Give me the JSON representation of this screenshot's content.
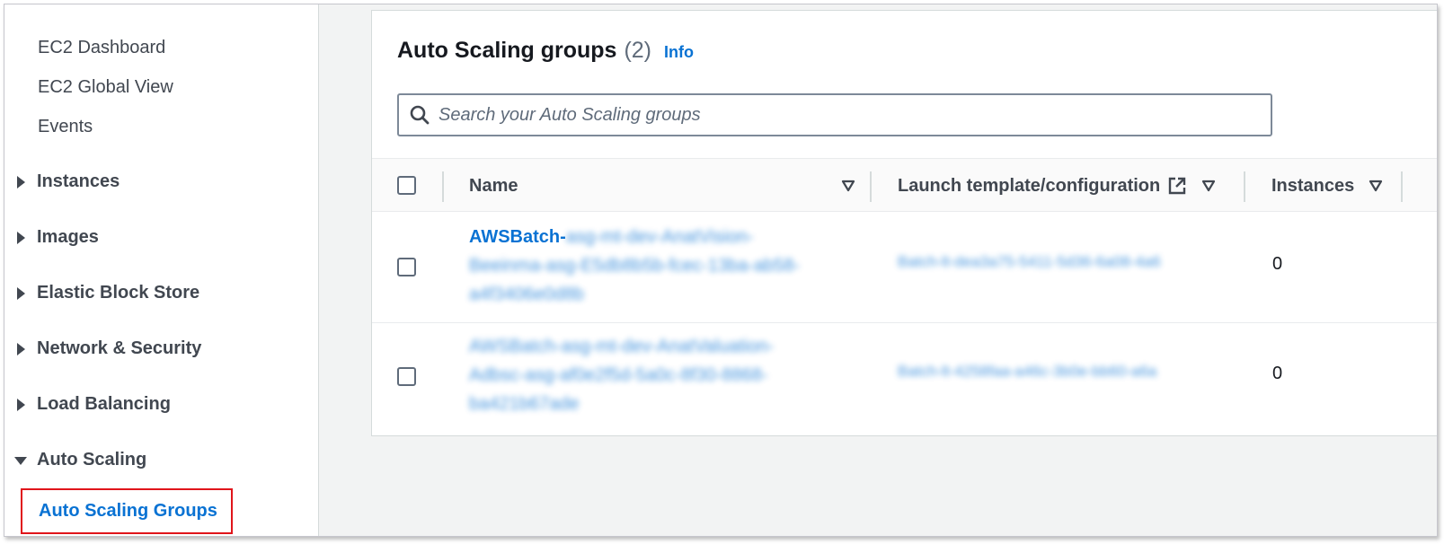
{
  "sidebar": {
    "links": [
      "EC2 Dashboard",
      "EC2 Global View",
      "Events"
    ],
    "sections": [
      "Instances",
      "Images",
      "Elastic Block Store",
      "Network & Security",
      "Load Balancing",
      "Auto Scaling"
    ],
    "active_item": "Auto Scaling Groups"
  },
  "main": {
    "title": "Auto Scaling groups",
    "count": "(2)",
    "info": "Info",
    "search_placeholder": "Search your Auto Scaling groups",
    "columns": {
      "name": "Name",
      "launch_template": "Launch template/configuration",
      "instances": "Instances"
    },
    "rows": [
      {
        "name_prefix": "AWSBatch-",
        "name_blurred_1": "asg-mt-dev-AnatVision-",
        "name_blurred_2": "Beeinma-asg-E5db8b5b-fcec-13ba-ab58-",
        "name_blurred_3": "a4f3406e0d8b",
        "launch_template": "Batch-lt-dea3a75-5411-5d36-6a08-4a6",
        "instances": "0"
      },
      {
        "name_prefix": "",
        "name_blurred_1": "AWSBatch-asg-mt-dev-AnatValuation-",
        "name_blurred_2": "Adbsc-asg-af0e2f5d-5a0c-8f30-8868-",
        "name_blurred_3": "ba421b67ade",
        "launch_template": "Batch-lt-4258faa-a46c-3b0e-bb60-a6a",
        "instances": "0"
      }
    ]
  },
  "icons": {
    "search": "search-icon",
    "caret_right": "caret-right-icon",
    "caret_down": "caret-down-icon",
    "sort": "sort-down-icon",
    "external": "external-link-icon"
  },
  "colors": {
    "link": "#0972d3",
    "highlight_border": "#e0151b",
    "text": "#16191f"
  }
}
